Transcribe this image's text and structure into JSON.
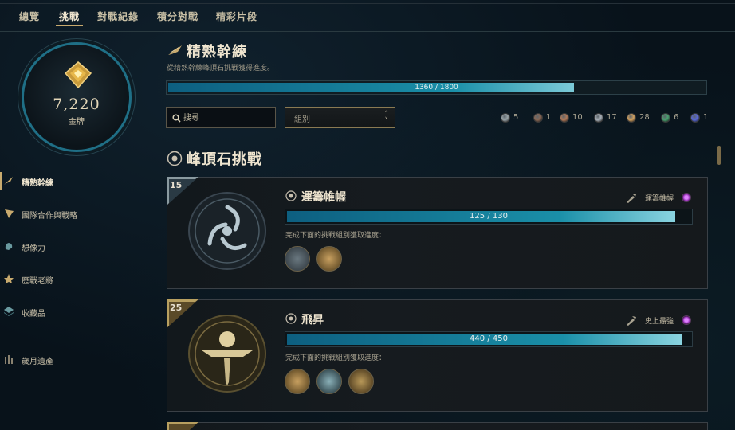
{
  "nav": {
    "tabs": [
      {
        "label": "總覽"
      },
      {
        "label": "挑戰"
      },
      {
        "label": "對戰紀錄"
      },
      {
        "label": "積分對戰"
      },
      {
        "label": "精彩片段"
      }
    ]
  },
  "profile": {
    "points": "7,220",
    "rank": "金牌"
  },
  "sidebar": {
    "items": [
      {
        "label": "精熟幹練",
        "icon": "blade-icon"
      },
      {
        "label": "團隊合作與戰略",
        "icon": "flag-icon"
      },
      {
        "label": "想像力",
        "icon": "imagination-icon"
      },
      {
        "label": "歷戰老將",
        "icon": "veteran-star-icon"
      },
      {
        "label": "收藏品",
        "icon": "collection-stack-icon"
      },
      {
        "label": "歲月遺產",
        "icon": "legacy-icon"
      }
    ]
  },
  "header": {
    "title": "精熟幹練",
    "subtitle": "從精熟幹練峰頂石挑戰獲得進度。",
    "progress_text": "1360 / 1800",
    "progress_fraction": 0.756
  },
  "filters": {
    "search_placeholder": "搜尋",
    "group_select": "組別"
  },
  "tier_counts": [
    {
      "count": "5",
      "color": "#9aa4a8"
    },
    {
      "count": "1",
      "color": "#8a6a58"
    },
    {
      "count": "10",
      "color": "#b07a5a"
    },
    {
      "count": "17",
      "color": "#a8b0b8"
    },
    {
      "count": "28",
      "color": "#d0a060"
    },
    {
      "count": "6",
      "color": "#4aa070"
    },
    {
      "count": "1",
      "color": "#5a6ad8"
    }
  ],
  "section": {
    "title": "峰頂石挑戰"
  },
  "cards": [
    {
      "level": "15",
      "title": "運籌帷幄",
      "reward_label": "運籌帷幄",
      "progress_text": "125 / 130",
      "progress_fraction": 0.962,
      "description": "完成下面的挑戰組別獲取進度：",
      "corner_color": "#8a9aa0"
    },
    {
      "level": "25",
      "title": "飛昇",
      "reward_label": "史上最強",
      "progress_text": "440 / 450",
      "progress_fraction": 0.978,
      "description": "完成下面的挑戰組別獲取進度：",
      "corner_color": "#b8a060"
    }
  ]
}
